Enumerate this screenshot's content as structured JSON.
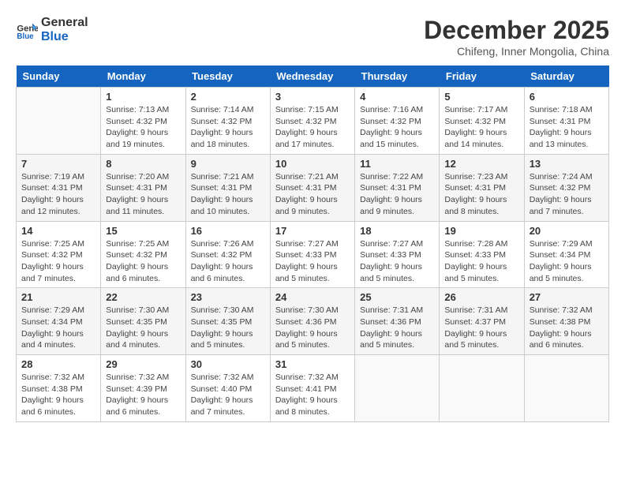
{
  "header": {
    "logo_line1": "General",
    "logo_line2": "Blue",
    "month_title": "December 2025",
    "location": "Chifeng, Inner Mongolia, China"
  },
  "days_of_week": [
    "Sunday",
    "Monday",
    "Tuesday",
    "Wednesday",
    "Thursday",
    "Friday",
    "Saturday"
  ],
  "weeks": [
    [
      {
        "day": "",
        "sunrise": "",
        "sunset": "",
        "daylight": ""
      },
      {
        "day": "1",
        "sunrise": "Sunrise: 7:13 AM",
        "sunset": "Sunset: 4:32 PM",
        "daylight": "Daylight: 9 hours and 19 minutes."
      },
      {
        "day": "2",
        "sunrise": "Sunrise: 7:14 AM",
        "sunset": "Sunset: 4:32 PM",
        "daylight": "Daylight: 9 hours and 18 minutes."
      },
      {
        "day": "3",
        "sunrise": "Sunrise: 7:15 AM",
        "sunset": "Sunset: 4:32 PM",
        "daylight": "Daylight: 9 hours and 17 minutes."
      },
      {
        "day": "4",
        "sunrise": "Sunrise: 7:16 AM",
        "sunset": "Sunset: 4:32 PM",
        "daylight": "Daylight: 9 hours and 15 minutes."
      },
      {
        "day": "5",
        "sunrise": "Sunrise: 7:17 AM",
        "sunset": "Sunset: 4:32 PM",
        "daylight": "Daylight: 9 hours and 14 minutes."
      },
      {
        "day": "6",
        "sunrise": "Sunrise: 7:18 AM",
        "sunset": "Sunset: 4:31 PM",
        "daylight": "Daylight: 9 hours and 13 minutes."
      }
    ],
    [
      {
        "day": "7",
        "sunrise": "Sunrise: 7:19 AM",
        "sunset": "Sunset: 4:31 PM",
        "daylight": "Daylight: 9 hours and 12 minutes."
      },
      {
        "day": "8",
        "sunrise": "Sunrise: 7:20 AM",
        "sunset": "Sunset: 4:31 PM",
        "daylight": "Daylight: 9 hours and 11 minutes."
      },
      {
        "day": "9",
        "sunrise": "Sunrise: 7:21 AM",
        "sunset": "Sunset: 4:31 PM",
        "daylight": "Daylight: 9 hours and 10 minutes."
      },
      {
        "day": "10",
        "sunrise": "Sunrise: 7:21 AM",
        "sunset": "Sunset: 4:31 PM",
        "daylight": "Daylight: 9 hours and 9 minutes."
      },
      {
        "day": "11",
        "sunrise": "Sunrise: 7:22 AM",
        "sunset": "Sunset: 4:31 PM",
        "daylight": "Daylight: 9 hours and 9 minutes."
      },
      {
        "day": "12",
        "sunrise": "Sunrise: 7:23 AM",
        "sunset": "Sunset: 4:31 PM",
        "daylight": "Daylight: 9 hours and 8 minutes."
      },
      {
        "day": "13",
        "sunrise": "Sunrise: 7:24 AM",
        "sunset": "Sunset: 4:32 PM",
        "daylight": "Daylight: 9 hours and 7 minutes."
      }
    ],
    [
      {
        "day": "14",
        "sunrise": "Sunrise: 7:25 AM",
        "sunset": "Sunset: 4:32 PM",
        "daylight": "Daylight: 9 hours and 7 minutes."
      },
      {
        "day": "15",
        "sunrise": "Sunrise: 7:25 AM",
        "sunset": "Sunset: 4:32 PM",
        "daylight": "Daylight: 9 hours and 6 minutes."
      },
      {
        "day": "16",
        "sunrise": "Sunrise: 7:26 AM",
        "sunset": "Sunset: 4:32 PM",
        "daylight": "Daylight: 9 hours and 6 minutes."
      },
      {
        "day": "17",
        "sunrise": "Sunrise: 7:27 AM",
        "sunset": "Sunset: 4:33 PM",
        "daylight": "Daylight: 9 hours and 5 minutes."
      },
      {
        "day": "18",
        "sunrise": "Sunrise: 7:27 AM",
        "sunset": "Sunset: 4:33 PM",
        "daylight": "Daylight: 9 hours and 5 minutes."
      },
      {
        "day": "19",
        "sunrise": "Sunrise: 7:28 AM",
        "sunset": "Sunset: 4:33 PM",
        "daylight": "Daylight: 9 hours and 5 minutes."
      },
      {
        "day": "20",
        "sunrise": "Sunrise: 7:29 AM",
        "sunset": "Sunset: 4:34 PM",
        "daylight": "Daylight: 9 hours and 5 minutes."
      }
    ],
    [
      {
        "day": "21",
        "sunrise": "Sunrise: 7:29 AM",
        "sunset": "Sunset: 4:34 PM",
        "daylight": "Daylight: 9 hours and 4 minutes."
      },
      {
        "day": "22",
        "sunrise": "Sunrise: 7:30 AM",
        "sunset": "Sunset: 4:35 PM",
        "daylight": "Daylight: 9 hours and 4 minutes."
      },
      {
        "day": "23",
        "sunrise": "Sunrise: 7:30 AM",
        "sunset": "Sunset: 4:35 PM",
        "daylight": "Daylight: 9 hours and 5 minutes."
      },
      {
        "day": "24",
        "sunrise": "Sunrise: 7:30 AM",
        "sunset": "Sunset: 4:36 PM",
        "daylight": "Daylight: 9 hours and 5 minutes."
      },
      {
        "day": "25",
        "sunrise": "Sunrise: 7:31 AM",
        "sunset": "Sunset: 4:36 PM",
        "daylight": "Daylight: 9 hours and 5 minutes."
      },
      {
        "day": "26",
        "sunrise": "Sunrise: 7:31 AM",
        "sunset": "Sunset: 4:37 PM",
        "daylight": "Daylight: 9 hours and 5 minutes."
      },
      {
        "day": "27",
        "sunrise": "Sunrise: 7:32 AM",
        "sunset": "Sunset: 4:38 PM",
        "daylight": "Daylight: 9 hours and 6 minutes."
      }
    ],
    [
      {
        "day": "28",
        "sunrise": "Sunrise: 7:32 AM",
        "sunset": "Sunset: 4:38 PM",
        "daylight": "Daylight: 9 hours and 6 minutes."
      },
      {
        "day": "29",
        "sunrise": "Sunrise: 7:32 AM",
        "sunset": "Sunset: 4:39 PM",
        "daylight": "Daylight: 9 hours and 6 minutes."
      },
      {
        "day": "30",
        "sunrise": "Sunrise: 7:32 AM",
        "sunset": "Sunset: 4:40 PM",
        "daylight": "Daylight: 9 hours and 7 minutes."
      },
      {
        "day": "31",
        "sunrise": "Sunrise: 7:32 AM",
        "sunset": "Sunset: 4:41 PM",
        "daylight": "Daylight: 9 hours and 8 minutes."
      },
      {
        "day": "",
        "sunrise": "",
        "sunset": "",
        "daylight": ""
      },
      {
        "day": "",
        "sunrise": "",
        "sunset": "",
        "daylight": ""
      },
      {
        "day": "",
        "sunrise": "",
        "sunset": "",
        "daylight": ""
      }
    ]
  ]
}
